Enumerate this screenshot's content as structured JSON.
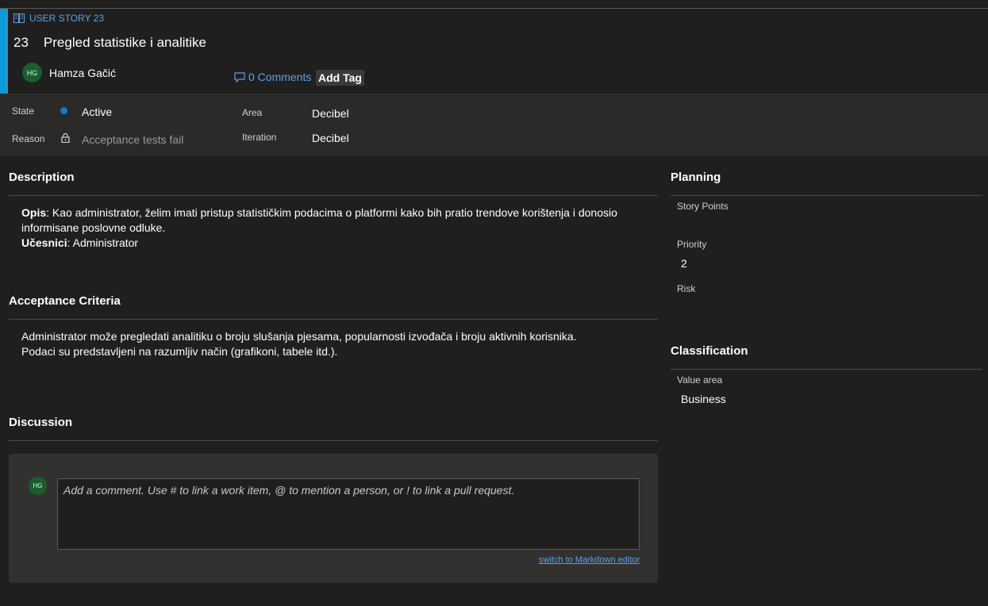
{
  "work_item": {
    "type_label": "USER STORY 23",
    "id": "23",
    "title": "Pregled statistike i analitike",
    "owner": {
      "initials": "HG",
      "name": "Hamza Gačić"
    },
    "comments_label": "0 Comments",
    "add_tag_label": "Add Tag"
  },
  "fields": {
    "state": {
      "label": "State",
      "value": "Active"
    },
    "reason": {
      "label": "Reason",
      "value": "Acceptance tests fail"
    },
    "area": {
      "label": "Area",
      "value": "Decibel"
    },
    "iteration": {
      "label": "Iteration",
      "value": "Decibel"
    }
  },
  "description": {
    "title": "Description",
    "opis_label": "Opis",
    "opis_text": ": Kao administrator, želim imati pristup statističkim podacima o platformi kako bih pratio trendove korištenja i donosio informisane poslovne odluke.",
    "ucesnici_label": "Učesnici",
    "ucesnici_text": ": Administrator"
  },
  "acceptance": {
    "title": "Acceptance Criteria",
    "line1": "Administrator može pregledati analitiku o broju slušanja pjesama, popularnosti izvođača i broju aktivnih korisnika.",
    "line2": "Podaci su predstavljeni na razumljiv način (grafikoni, tabele itd.)."
  },
  "discussion": {
    "title": "Discussion",
    "avatar_initials": "HG",
    "placeholder": "Add a comment. Use # to link a work item, @ to mention a person, or ! to link a pull request.",
    "markdown_link": "switch to Markdown editor"
  },
  "planning": {
    "title": "Planning",
    "story_points_label": "Story Points",
    "priority_label": "Priority",
    "priority_value": "2",
    "risk_label": "Risk"
  },
  "classification": {
    "title": "Classification",
    "value_area_label": "Value area",
    "value_area_value": "Business"
  },
  "colors": {
    "accent": "#0f9bd7",
    "link": "#56a3e8",
    "state_active": "#0f7ad7",
    "avatar_bg": "#1a5e2f"
  },
  "icons": [
    "book-icon",
    "comment-icon",
    "lock-icon",
    "state-dot"
  ]
}
